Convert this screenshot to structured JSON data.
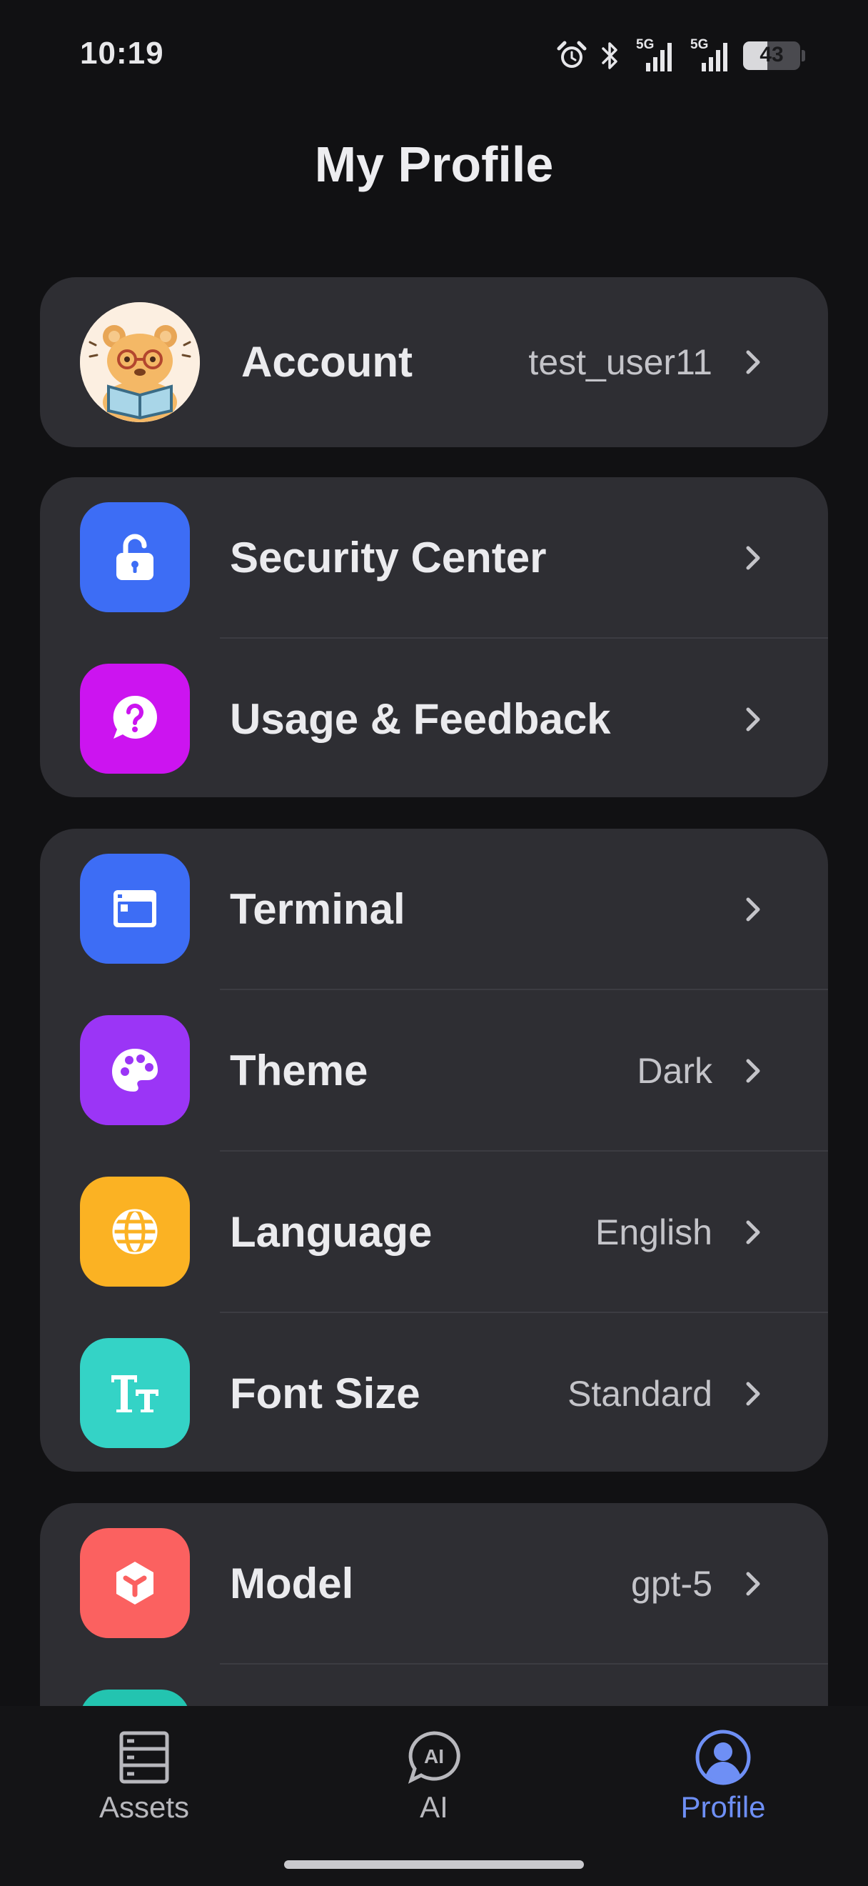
{
  "status_bar": {
    "time": "10:19",
    "icons": [
      "alarm-icon",
      "bluetooth-icon",
      "signal-5g-icon",
      "signal-5g-icon"
    ],
    "network_label_1": "5G",
    "network_label_2": "5G",
    "battery_percent": "43"
  },
  "header": {
    "title": "My Profile"
  },
  "account": {
    "label": "Account",
    "value": "test_user11",
    "avatar_icon": "bear-avatar"
  },
  "groups": {
    "support": [
      {
        "label": "Security Center",
        "value": "",
        "icon": "unlock-icon",
        "color": "#3d6df5"
      },
      {
        "label": "Usage & Feedback",
        "value": "",
        "icon": "help-bubble-icon",
        "color": "#cc14f0"
      }
    ],
    "settings": [
      {
        "label": "Terminal",
        "value": "",
        "icon": "terminal-window-icon",
        "color": "#3d6df5"
      },
      {
        "label": "Theme",
        "value": "Dark",
        "icon": "palette-icon",
        "color": "#9b35f6"
      },
      {
        "label": "Language",
        "value": "English",
        "icon": "globe-icon",
        "color": "#fbb223"
      },
      {
        "label": "Font Size",
        "value": "Standard",
        "icon": "font-size-icon",
        "color": "#34d3c6"
      }
    ],
    "ai": [
      {
        "label": "Model",
        "value": "gpt-5",
        "icon": "cube-icon",
        "color": "#fb6160"
      }
    ]
  },
  "tab_bar": {
    "tabs": [
      {
        "label": "Assets",
        "icon": "server-stack-icon",
        "active": false
      },
      {
        "label": "AI",
        "icon": "ai-chat-icon",
        "active": false
      },
      {
        "label": "Profile",
        "icon": "user-circle-icon",
        "active": true
      }
    ],
    "active_color": "#6e8ff5"
  }
}
